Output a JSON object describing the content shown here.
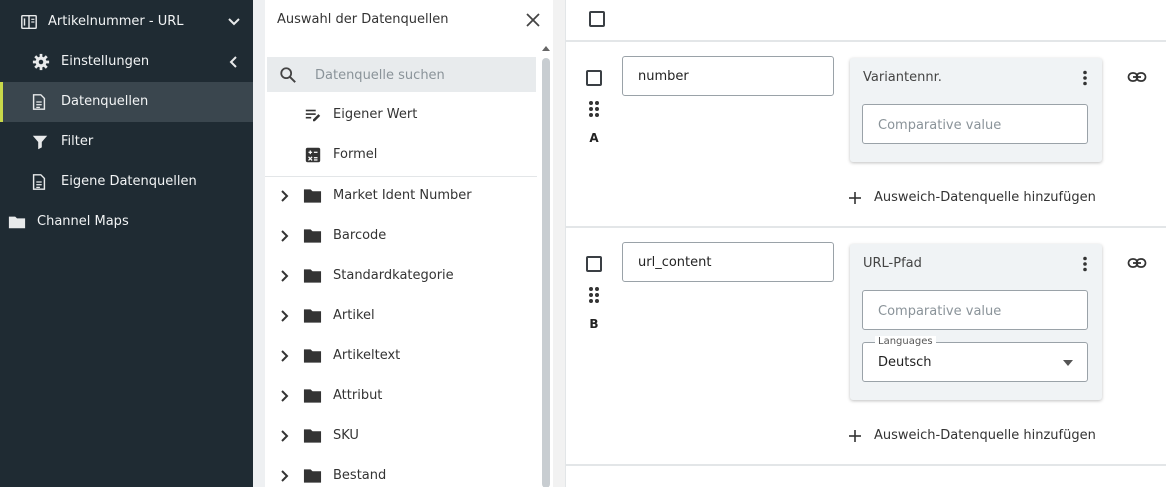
{
  "sidebar": {
    "items": [
      {
        "label": "Artikelnummer - URL",
        "icon": "book-icon",
        "chevron": "chevron-down-icon",
        "active": false
      },
      {
        "label": "Einstellungen",
        "icon": "gear-icon",
        "chevron": "chevron-left-icon",
        "active": false
      },
      {
        "label": "Datenquellen",
        "icon": "document-icon",
        "chevron": "",
        "active": true
      },
      {
        "label": "Filter",
        "icon": "filter-icon",
        "chevron": "",
        "active": false
      },
      {
        "label": "Eigene Datenquellen",
        "icon": "document-icon",
        "chevron": "",
        "active": false
      },
      {
        "label": "Channel Maps",
        "icon": "folder-icon",
        "chevron": "",
        "active": false
      }
    ]
  },
  "panel": {
    "title": "Auswahl der Datenquellen",
    "search_placeholder": "Datenquelle suchen",
    "special_items": [
      {
        "label": "Eigener Wert",
        "icon": "edit-list-icon"
      },
      {
        "label": "Formel",
        "icon": "calculator-icon"
      }
    ],
    "tree_items": [
      {
        "label": "Market Ident Number"
      },
      {
        "label": "Barcode"
      },
      {
        "label": "Standardkategorie"
      },
      {
        "label": "Artikel"
      },
      {
        "label": "Artikeltext"
      },
      {
        "label": "Attribut"
      },
      {
        "label": "SKU"
      },
      {
        "label": "Bestand"
      }
    ]
  },
  "rows": [
    {
      "letter": "A",
      "key": "number",
      "source_title": "Variantennr.",
      "comparative_placeholder": "Comparative value",
      "add_fallback": "Ausweich-Datenquelle hinzufügen"
    },
    {
      "letter": "B",
      "key": "url_content",
      "source_title": "URL-Pfad",
      "comparative_placeholder": "Comparative value",
      "languages_label": "Languages",
      "languages_value": "Deutsch",
      "add_fallback": "Ausweich-Datenquelle hinzufügen"
    }
  ],
  "colors": {
    "sidebar_bg": "#1f2b33",
    "active_bg": "#3a464e",
    "active_accent": "#c8d84a"
  }
}
